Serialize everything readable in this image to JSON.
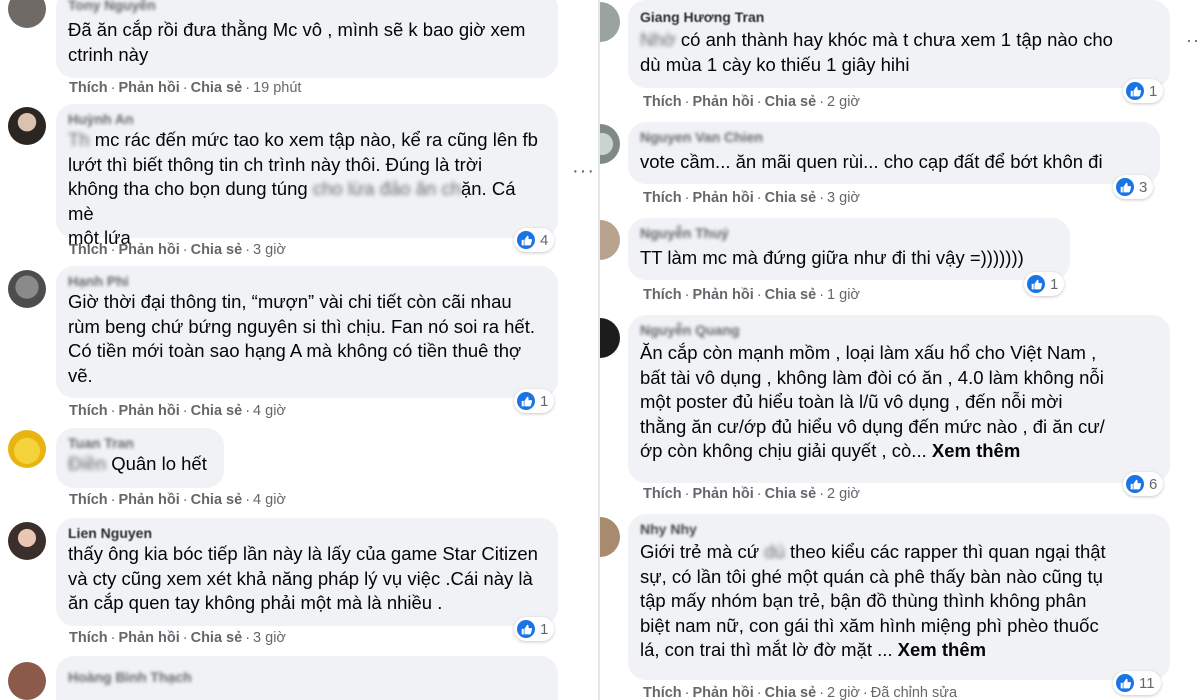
{
  "actions": {
    "like": "Thích",
    "reply": "Phản hồi",
    "share": "Chia sẻ",
    "sep": "·"
  },
  "more_label": "Xem thêm",
  "left": [
    {
      "author": "Tony Nguyễn",
      "lines": [
        "Đã ăn cắp rồi đưa thằng Mc vô , mình sẽ k bao giờ xem",
        "ctrinh này"
      ],
      "time": "19 phút"
    },
    {
      "author": "Huỳnh An",
      "lines": [
        "mc rác đến mức tao ko xem tập nào, kể ra cũng lên fb",
        "lướt thì biết thông tin ch trình này thôi. Đúng là trời",
        "không tha cho bọn dung túng",
        "ặn. Cá mè",
        "một lứa"
      ],
      "blurred": [
        "Th",
        "cho lừa đảo ăn ch"
      ],
      "time": "3 giờ",
      "reactions": "4"
    },
    {
      "author": "Hạnh Phi",
      "lines": [
        "Giờ thời đại thông tin, “mượn” vài chi tiết còn cãi nhau",
        "rùm beng chứ bứng nguyên si thì chịu. Fan nó soi ra hết.",
        "Có tiền mới toàn sao hạng A mà không có tiền thuê thợ",
        "vẽ."
      ],
      "time": "4 giờ",
      "reactions": "1"
    },
    {
      "author": "Tuan Tran",
      "lines": [
        "Quân lo hết"
      ],
      "blurred": [
        "Điền"
      ],
      "time": "4 giờ"
    },
    {
      "author": "Lien Nguyen",
      "lines": [
        "thấy ông kia bóc tiếp lần này là lấy của game Star Citizen",
        "và cty cũng xem xét khả năng pháp lý vụ việc .Cái này là",
        "ăn cắp quen tay không phải một mà là nhiều ."
      ],
      "time": "3 giờ",
      "reactions": "1"
    },
    {
      "author": "Hoàng Bình Thạch"
    }
  ],
  "right": [
    {
      "author": "Giang Hương Tran",
      "lines": [
        "có anh thành hay khóc mà t chưa xem 1 tập nào cho",
        "dù mùa 1 cày ko thiếu 1 giây hihi"
      ],
      "blurred": [
        "Nhờ"
      ],
      "time": "2 giờ",
      "reactions": "1"
    },
    {
      "author": "Nguyen Van Chien",
      "lines": [
        "vote cầm... ăn mãi quen rùi... cho cạp đất để bớt khôn đi"
      ],
      "time": "3 giờ",
      "reactions": "3"
    },
    {
      "author": "Nguyễn Thuý",
      "lines": [
        "TT làm mc mà đứng giữa như đi thi vậy =)))))))"
      ],
      "time": "1 giờ",
      "reactions": "1"
    },
    {
      "author": "Nguyễn Quang",
      "lines": [
        "Ăn cắp còn mạnh mồm , loại làm xấu hổ cho Việt Nam ,",
        "bất tài vô dụng , không làm đòi có ăn , 4.0 làm không nỗi",
        "một poster đủ hiểu toàn là l/ũ vô dụng , đến nỗi mời",
        "thằng ăn cư/ớp đủ hiểu vô dụng đến mức nào , đi ăn cư/",
        "ớp còn không chịu giải quyết , cò..."
      ],
      "time": "2 giờ",
      "reactions": "6"
    },
    {
      "author": "Nhy Nhy",
      "lines": [
        "Giới trẻ mà cứ",
        " theo kiểu các rapper thì quan ngại thật",
        "sự, có lần tôi ghé một quán cà phê thấy bàn nào cũng tụ",
        "tập mấy nhóm bạn trẻ, bận đồ thùng thình không phân",
        "biệt nam nữ, con gái thì xăm hình miệng phì phèo thuốc",
        "lá, con trai thì mắt lờ đờ mặt ..."
      ],
      "blurred": [
        "dú"
      ],
      "time": "2 giờ",
      "edited": "Đã chỉnh sửa",
      "reactions": "11"
    }
  ],
  "colors": {
    "bubble": "#f0f2f5",
    "like": "#1b74e4",
    "meta": "#65676b",
    "text": "#050505"
  },
  "icons": [
    "like-icon",
    "more-options-icon",
    "close-icon"
  ]
}
